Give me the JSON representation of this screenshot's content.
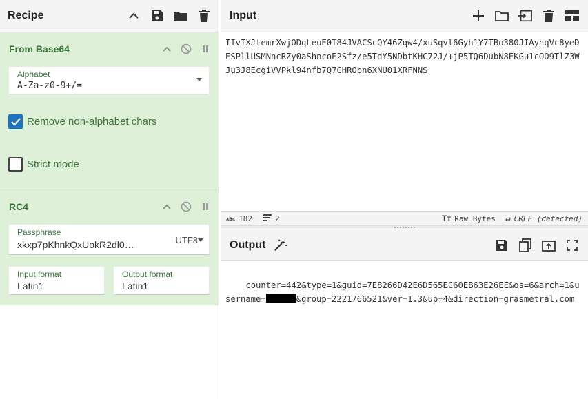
{
  "recipe": {
    "title": "Recipe",
    "operations": [
      {
        "title": "From Base64",
        "alphabet_label": "Alphabet",
        "alphabet_value": "A-Za-z0-9+/=",
        "remove_label": "Remove non-alphabet chars",
        "remove_checked": true,
        "strict_label": "Strict mode",
        "strict_checked": false
      },
      {
        "title": "RC4",
        "passphrase_label": "Passphrase",
        "passphrase_value": "xkxp7pKhnkQxUokR2dl0…",
        "passphrase_encoding": "UTF8",
        "input_format_label": "Input format",
        "input_format_value": "Latin1",
        "output_format_label": "Output format",
        "output_format_value": "Latin1"
      }
    ]
  },
  "input": {
    "title": "Input",
    "text": "IIvIXJtemrXwjODqLeuE0T84JVACScQY46Zqw4/xuSqvl6Gyh1Y7TBo380JIAyhqVc8yeDESPllUSMNncRZy0aShncoE2Sfz/e5TdY5NDbtKHC72J/+jP5TQ6DubN8EKGu1cOO9TlZ3WJu3J8EcgiVVPkl94nfb7Q7CHROpn6XNU01XRFNNS",
    "char_count": "182",
    "line_count": "2",
    "encoding": "Raw Bytes",
    "eol": "CRLF (detected)"
  },
  "output": {
    "title": "Output",
    "text_before": "counter=442&type=1&guid=7E8266D42E6D565EC60EB63E26EE&os=6&arch=1&username=",
    "text_after": "&group=2221766521&ver=1.3&up=4&direction=grasmetral.com"
  }
}
